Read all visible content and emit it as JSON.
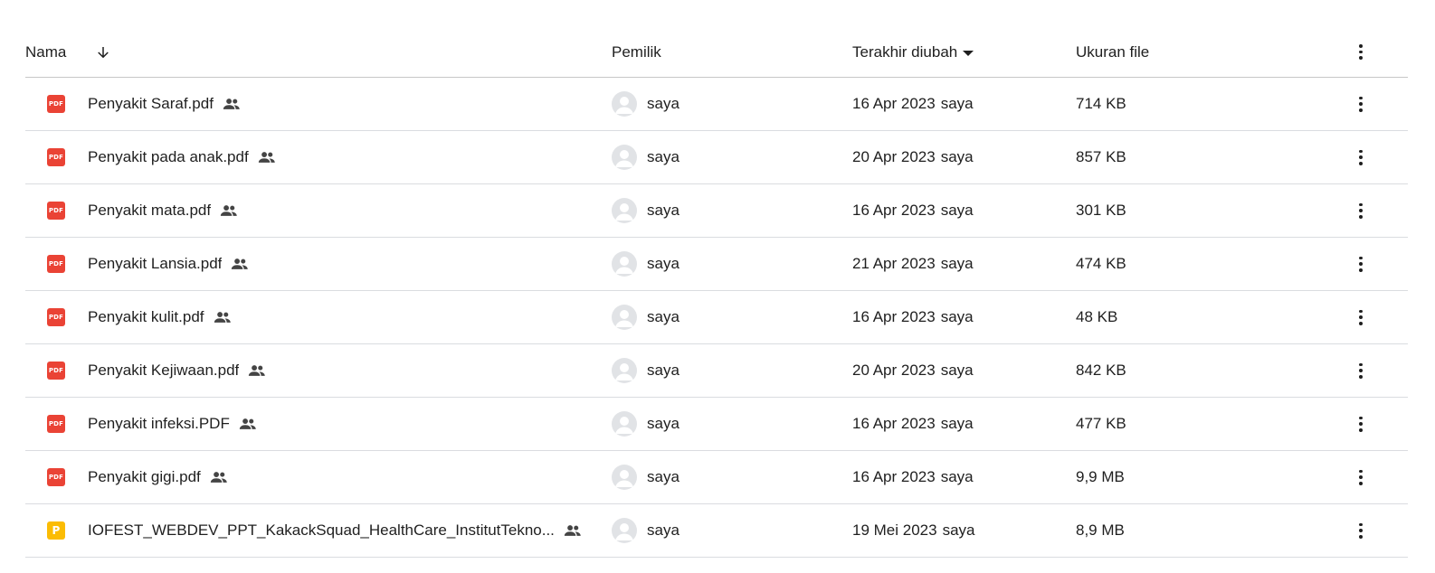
{
  "header": {
    "name_label": "Nama",
    "owner_label": "Pemilik",
    "modified_label": "Terakhir diubah",
    "size_label": "Ukuran file"
  },
  "files": [
    {
      "icon": "pdf-icon",
      "icon_text": "PDF",
      "name": "Penyakit Saraf.pdf",
      "owner": "saya",
      "modified_date": "16 Apr 2023",
      "modified_by": "saya",
      "size": "714 KB"
    },
    {
      "icon": "pdf-icon",
      "icon_text": "PDF",
      "name": "Penyakit pada anak.pdf",
      "owner": "saya",
      "modified_date": "20 Apr 2023",
      "modified_by": "saya",
      "size": "857 KB"
    },
    {
      "icon": "pdf-icon",
      "icon_text": "PDF",
      "name": "Penyakit mata.pdf",
      "owner": "saya",
      "modified_date": "16 Apr 2023",
      "modified_by": "saya",
      "size": "301 KB"
    },
    {
      "icon": "pdf-icon",
      "icon_text": "PDF",
      "name": "Penyakit Lansia.pdf",
      "owner": "saya",
      "modified_date": "21 Apr 2023",
      "modified_by": "saya",
      "size": "474 KB"
    },
    {
      "icon": "pdf-icon",
      "icon_text": "PDF",
      "name": "Penyakit kulit.pdf",
      "owner": "saya",
      "modified_date": "16 Apr 2023",
      "modified_by": "saya",
      "size": "48 KB"
    },
    {
      "icon": "pdf-icon",
      "icon_text": "PDF",
      "name": "Penyakit Kejiwaan.pdf",
      "owner": "saya",
      "modified_date": "20 Apr 2023",
      "modified_by": "saya",
      "size": "842 KB"
    },
    {
      "icon": "pdf-icon",
      "icon_text": "PDF",
      "name": "Penyakit infeksi.PDF",
      "owner": "saya",
      "modified_date": "16 Apr 2023",
      "modified_by": "saya",
      "size": "477 KB"
    },
    {
      "icon": "pdf-icon",
      "icon_text": "PDF",
      "name": "Penyakit gigi.pdf",
      "owner": "saya",
      "modified_date": "16 Apr 2023",
      "modified_by": "saya",
      "size": "9,9 MB"
    },
    {
      "icon": "slides-icon",
      "icon_text": "P",
      "name": "IOFEST_WEBDEV_PPT_KakackSquad_HealthCare_InstitutTekno...",
      "owner": "saya",
      "modified_date": "19 Mei 2023",
      "modified_by": "saya",
      "size": "8,9 MB"
    }
  ],
  "colors": {
    "pdf": "#ea4335",
    "slides": "#fbbc04",
    "divider": "#dadce0",
    "text": "#1f1f1f"
  }
}
